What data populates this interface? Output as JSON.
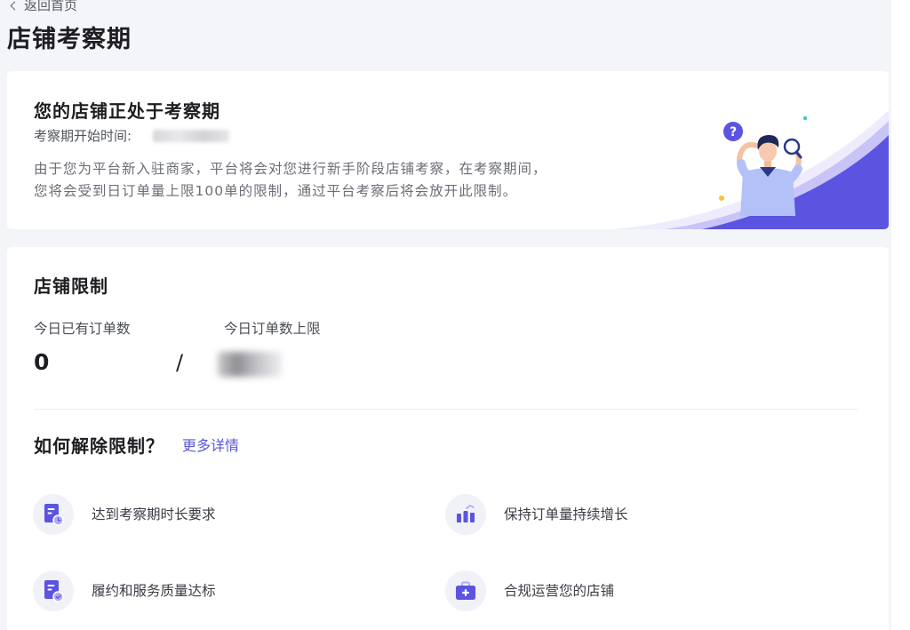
{
  "theme": {
    "accent": "#5b54e0",
    "link": "#5a57d8",
    "page_bg": "#f4f5f9",
    "icon_bg": "#f1f1f8"
  },
  "nav": {
    "back_label": "返回首页",
    "back_icon": "chevron-left-icon"
  },
  "page": {
    "title": "店铺考察期"
  },
  "notice": {
    "heading": "您的店铺正处于考察期",
    "start_time_label": "考察期开始时间:",
    "description": [
      "由于您为平台新入驻商家，平台将会对您进行新手阶段店铺考察，在考察期间，",
      "您将会受到日订单量上限100单的限制，通过平台考察后将会放开此限制。"
    ],
    "illustration": {
      "name": "person-with-magnifier-illustration",
      "badge_glyph": "?"
    }
  },
  "limits": {
    "heading": "店铺限制",
    "today_orders_label": "今日已有订单数",
    "today_orders_value": "0",
    "separator": "/",
    "daily_limit_label": "今日订单数上限"
  },
  "unlock": {
    "heading": "如何解除限制？",
    "more_link": "更多详情",
    "items": [
      {
        "label": "达到考察期时长要求",
        "icon": "document-clock-icon"
      },
      {
        "label": "保持订单量持续增长",
        "icon": "bar-chart-icon"
      },
      {
        "label": "履约和服务质量达标",
        "icon": "document-check-icon"
      },
      {
        "label": "合规运营您的店铺",
        "icon": "briefcase-plus-icon"
      }
    ]
  }
}
